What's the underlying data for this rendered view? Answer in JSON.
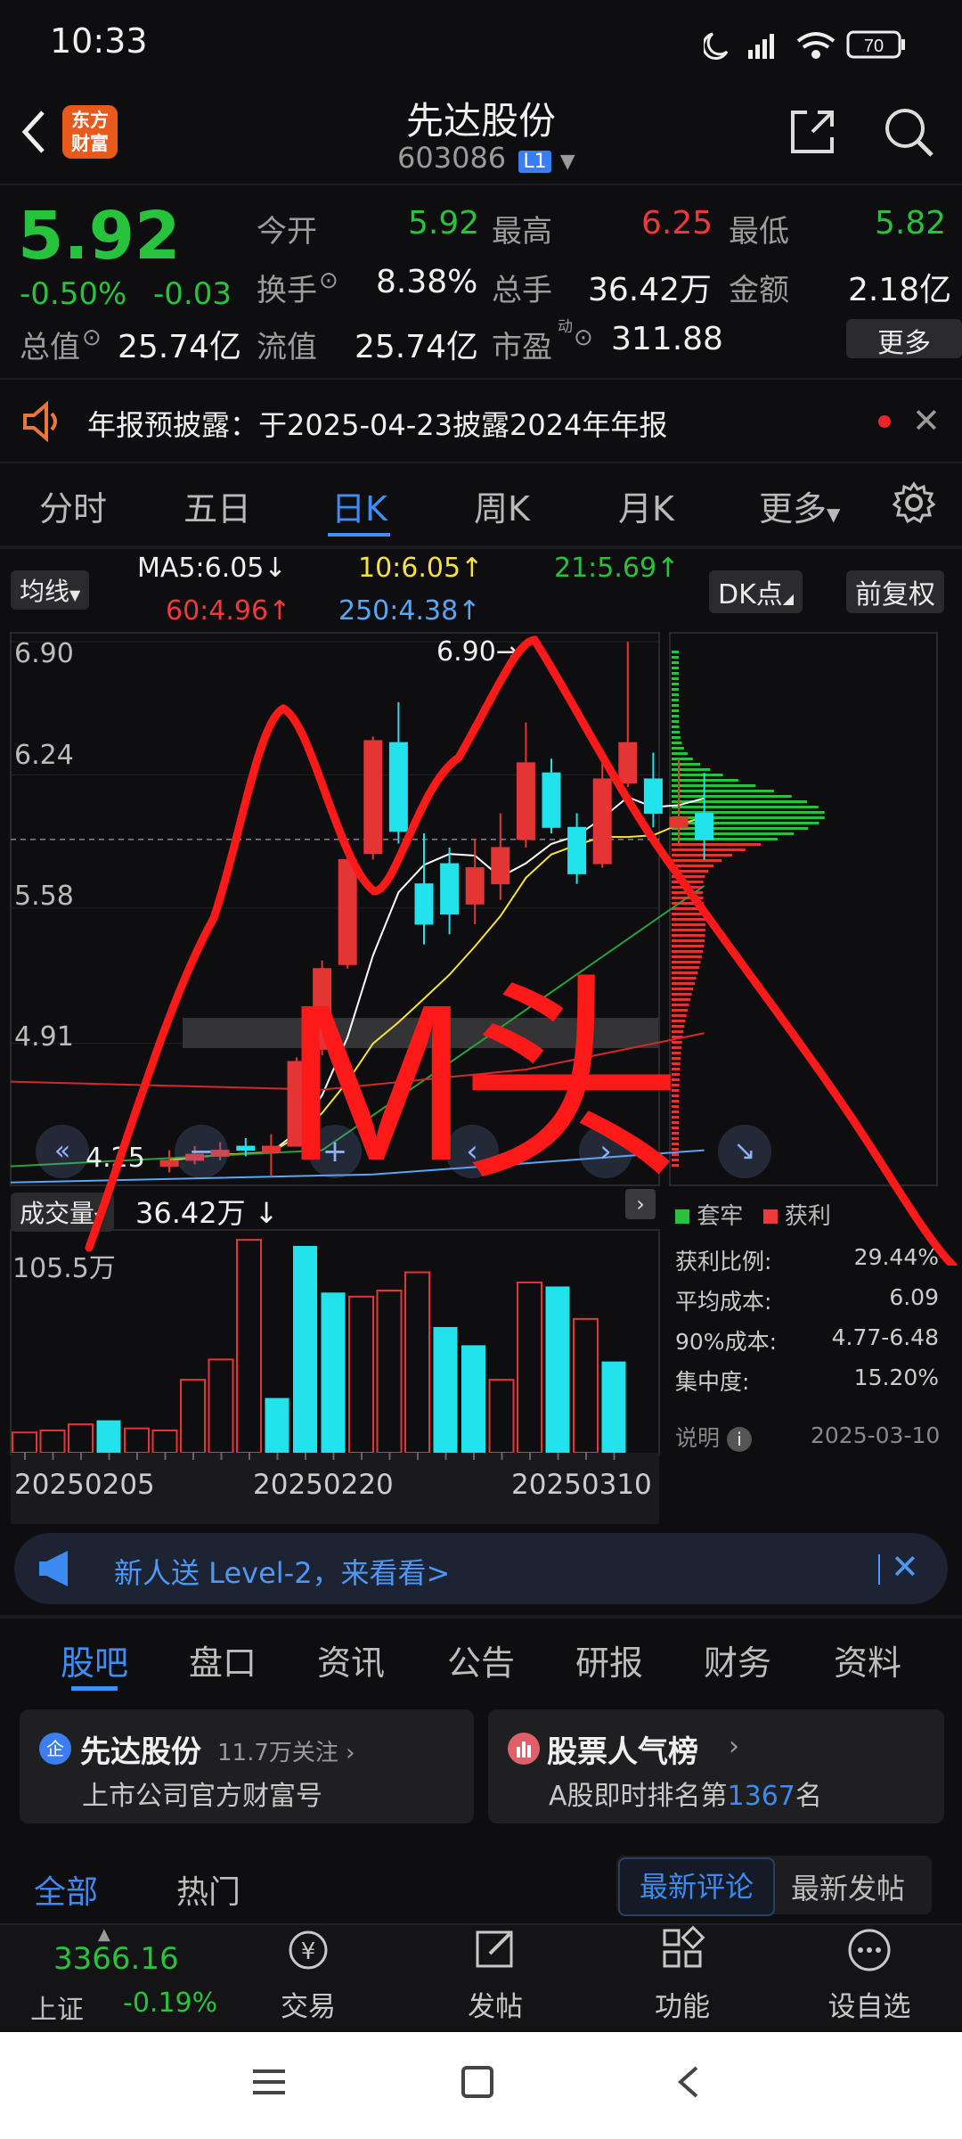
{
  "status_bar": {
    "time": "10:33",
    "battery": "70"
  },
  "header": {
    "logo_text": "东方\n财富",
    "title": "先达股份",
    "code": "603086",
    "level": "L1"
  },
  "quote": {
    "price": "5.92",
    "change_pct": "-0.50%",
    "change": "-0.03",
    "open_label": "今开",
    "open": "5.92",
    "high_label": "最高",
    "high": "6.25",
    "low_label": "最低",
    "low": "5.82",
    "turnover_label": "换手",
    "turnover": "8.38%",
    "volume_label": "总手",
    "volume": "36.42万",
    "amount_label": "金额",
    "amount": "2.18亿",
    "mktcap_label": "总值",
    "mktcap": "25.74亿",
    "float_label": "流值",
    "float": "25.74亿",
    "pe_label": "市盈",
    "pe_sup": "动",
    "pe": "311.88",
    "more": "更多"
  },
  "notice": {
    "text": "年报预披露：于2025-04-23披露2024年年报"
  },
  "chart_tabs": [
    "分时",
    "五日",
    "日K",
    "周K",
    "月K",
    "更多"
  ],
  "chart_tab_active": "日K",
  "ma_bar": {
    "selector": "均线",
    "ma5": "MA5:6.05",
    "ma10": "10:6.05",
    "ma21": "21:5.69",
    "ma60": "60:4.96",
    "ma250": "250:4.38",
    "dk": "DK点",
    "adjust": "前复权"
  },
  "price_axis": [
    "6.90",
    "6.24",
    "5.58",
    "4.91"
  ],
  "annotation": {
    "peak": "6.90→",
    "low": "4.25",
    "big_text": "M头"
  },
  "volume_bar": {
    "label": "成交量",
    "value": "36.42万",
    "axis_top": "105.5万"
  },
  "date_axis": [
    "20250205",
    "20250220",
    "20250310"
  ],
  "chip": {
    "legend_trapped": "套牢",
    "legend_profit": "获利",
    "rows": [
      {
        "k": "获利比例:",
        "v": "29.44%"
      },
      {
        "k": "平均成本:",
        "v": "6.09"
      },
      {
        "k": "90%成本:",
        "v": "4.77-6.48"
      },
      {
        "k": "集中度:",
        "v": "15.20%"
      }
    ],
    "note": "说明",
    "date": "2025-03-10"
  },
  "chart_data": {
    "type": "candlestick",
    "dates_visible": [
      "20250205",
      "20250220",
      "20250310"
    ],
    "candles": [
      {
        "o": 4.3,
        "c": 4.33,
        "h": 4.38,
        "l": 4.27
      },
      {
        "o": 4.33,
        "c": 4.36,
        "h": 4.4,
        "l": 4.31
      },
      {
        "o": 4.35,
        "c": 4.38,
        "h": 4.42,
        "l": 4.33
      },
      {
        "o": 4.4,
        "c": 4.38,
        "h": 4.44,
        "l": 4.35
      },
      {
        "o": 4.37,
        "c": 4.4,
        "h": 4.46,
        "l": 4.25
      },
      {
        "o": 4.4,
        "c": 4.82,
        "h": 4.84,
        "l": 4.4
      },
      {
        "o": 4.88,
        "c": 5.28,
        "h": 5.32,
        "l": 4.85
      },
      {
        "o": 5.3,
        "c": 5.82,
        "h": 5.85,
        "l": 5.28
      },
      {
        "o": 5.85,
        "c": 6.41,
        "h": 6.43,
        "l": 5.82
      },
      {
        "o": 6.4,
        "c": 5.96,
        "h": 6.6,
        "l": 5.9
      },
      {
        "o": 5.7,
        "c": 5.5,
        "h": 5.95,
        "l": 5.4
      },
      {
        "o": 5.8,
        "c": 5.55,
        "h": 5.88,
        "l": 5.45
      },
      {
        "o": 5.6,
        "c": 5.78,
        "h": 5.92,
        "l": 5.5
      },
      {
        "o": 5.7,
        "c": 5.88,
        "h": 6.05,
        "l": 5.62
      },
      {
        "o": 5.92,
        "c": 6.3,
        "h": 6.5,
        "l": 5.88
      },
      {
        "o": 6.25,
        "c": 5.98,
        "h": 6.32,
        "l": 5.95
      },
      {
        "o": 5.98,
        "c": 5.75,
        "h": 6.05,
        "l": 5.7
      },
      {
        "o": 5.8,
        "c": 6.22,
        "h": 6.3,
        "l": 5.78
      },
      {
        "o": 6.2,
        "c": 6.4,
        "h": 6.9,
        "l": 6.18
      },
      {
        "o": 6.22,
        "c": 6.05,
        "h": 6.35,
        "l": 5.98
      },
      {
        "o": 5.98,
        "c": 6.03,
        "h": 6.32,
        "l": 5.9
      },
      {
        "o": 6.05,
        "c": 5.92,
        "h": 6.25,
        "l": 5.82
      }
    ],
    "volumes": [
      10,
      11,
      14,
      16,
      12,
      11,
      36,
      46,
      105,
      27,
      102,
      79,
      77,
      80,
      89,
      62,
      53,
      36,
      84,
      82,
      66,
      45
    ],
    "price_ylim": [
      4.25,
      6.9
    ],
    "volume_ymax": 105.5,
    "ma_last": {
      "MA5": 6.05,
      "MA10": 6.05,
      "MA21": 5.69,
      "MA60": 4.96,
      "MA250": 4.38
    }
  },
  "ad_banner": {
    "text": "新人送 Level-2，来看看>"
  },
  "bottom_tabs": [
    "股吧",
    "盘口",
    "资讯",
    "公告",
    "研报",
    "财务",
    "资料"
  ],
  "cards": [
    {
      "title": "先达股份",
      "extra": "11.7万关注",
      "sub": "上市公司官方财富号"
    },
    {
      "title": "股票人气榜",
      "sub_pre": "A股即时排名第",
      "rank": "1367",
      "sub_post": "名"
    }
  ],
  "feed_tabs": {
    "all": "全部",
    "hot": "热门",
    "latest_comment": "最新评论",
    "latest_post": "最新发帖"
  },
  "index": {
    "value": "3366.16",
    "name": "上证",
    "change": "-0.19%"
  },
  "nav": [
    {
      "label": "交易",
      "icon": "yen-exchange-icon"
    },
    {
      "label": "发帖",
      "icon": "edit-icon"
    },
    {
      "label": "功能",
      "icon": "grid-icon"
    },
    {
      "label": "设自选",
      "icon": "more-dots-icon"
    }
  ]
}
